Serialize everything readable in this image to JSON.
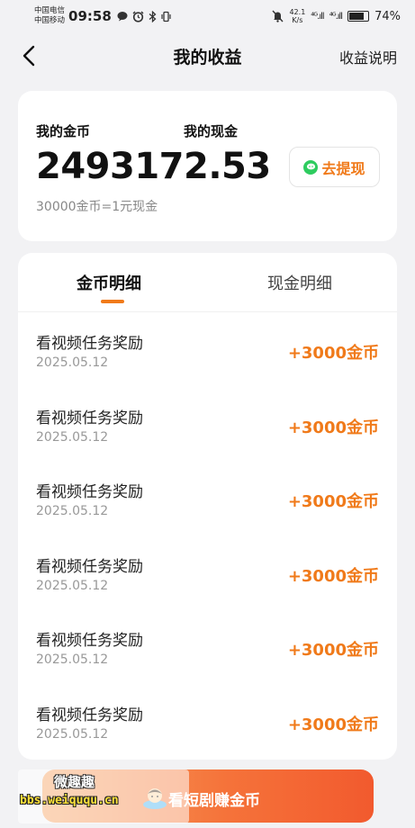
{
  "status_bar": {
    "carrier_1": "中国电信",
    "carrier_2": "中国移动",
    "time": "09:58",
    "net_speed_value": "42.1",
    "net_speed_unit": "K/s",
    "battery": "74%",
    "signal_1": "⁴ᴳ.ıll",
    "signal_2": "⁴ᴳ.ıll"
  },
  "nav": {
    "title": "我的收益",
    "right_link": "收益说明"
  },
  "balance": {
    "coin_label": "我的金币",
    "coin_value": "249317",
    "cash_label": "我的现金",
    "cash_value": "2.53",
    "rate_text": "30000金币=1元现金",
    "withdraw_label": "去提现"
  },
  "tabs": [
    {
      "label": "金币明细",
      "active": true
    },
    {
      "label": "现金明细",
      "active": false
    }
  ],
  "records": [
    {
      "title": "看视频任务奖励",
      "date": "2025.05.12",
      "amount": "+3000金币"
    },
    {
      "title": "看视频任务奖励",
      "date": "2025.05.12",
      "amount": "+3000金币"
    },
    {
      "title": "看视频任务奖励",
      "date": "2025.05.12",
      "amount": "+3000金币"
    },
    {
      "title": "看视频任务奖励",
      "date": "2025.05.12",
      "amount": "+3000金币"
    },
    {
      "title": "看视频任务奖励",
      "date": "2025.05.12",
      "amount": "+3000金币"
    },
    {
      "title": "看视频任务奖励",
      "date": "2025.05.12",
      "amount": "+3000金币"
    }
  ],
  "banner": {
    "text": "看短剧赚金币"
  },
  "watermark": {
    "line1": "微趣趣",
    "line2": "bbs.weiququ.cn"
  },
  "colors": {
    "accent": "#f07a1a",
    "wechat_green": "#2ecc5f"
  }
}
